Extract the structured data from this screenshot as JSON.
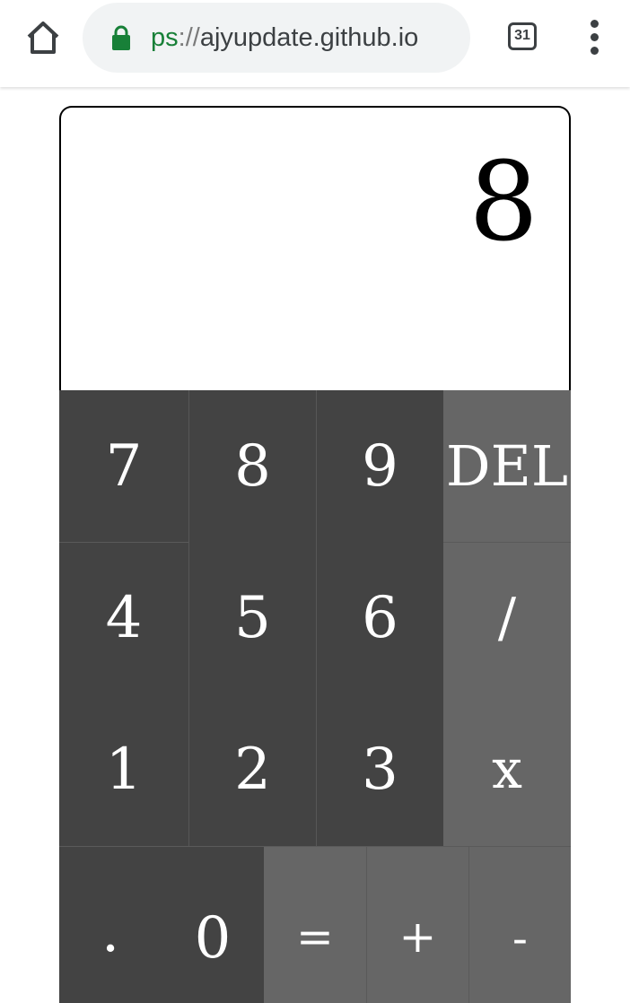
{
  "browser": {
    "url_scheme": "ps",
    "url_sep": "://",
    "url_host": "ajyupdate.github.io",
    "tab_count": "31",
    "icons": {
      "home": "home-icon",
      "lock": "lock-icon",
      "menu": "more-vert-icon"
    },
    "colors": {
      "secure": "#188038",
      "url_bg": "#f1f3f4"
    }
  },
  "calculator": {
    "display_value": "8",
    "keys": {
      "seven": "7",
      "eight": "8",
      "nine": "9",
      "del": "DEL",
      "four": "4",
      "five": "5",
      "six": "6",
      "divide": "/",
      "one": "1",
      "two": "2",
      "three": "3",
      "multiply": "x",
      "dot": ".",
      "zero": "0",
      "equals": "=",
      "plus": "+",
      "minus": "-"
    },
    "colors": {
      "number_key": "#434343",
      "operator_key": "#666666",
      "key_text": "#ffffff"
    }
  }
}
